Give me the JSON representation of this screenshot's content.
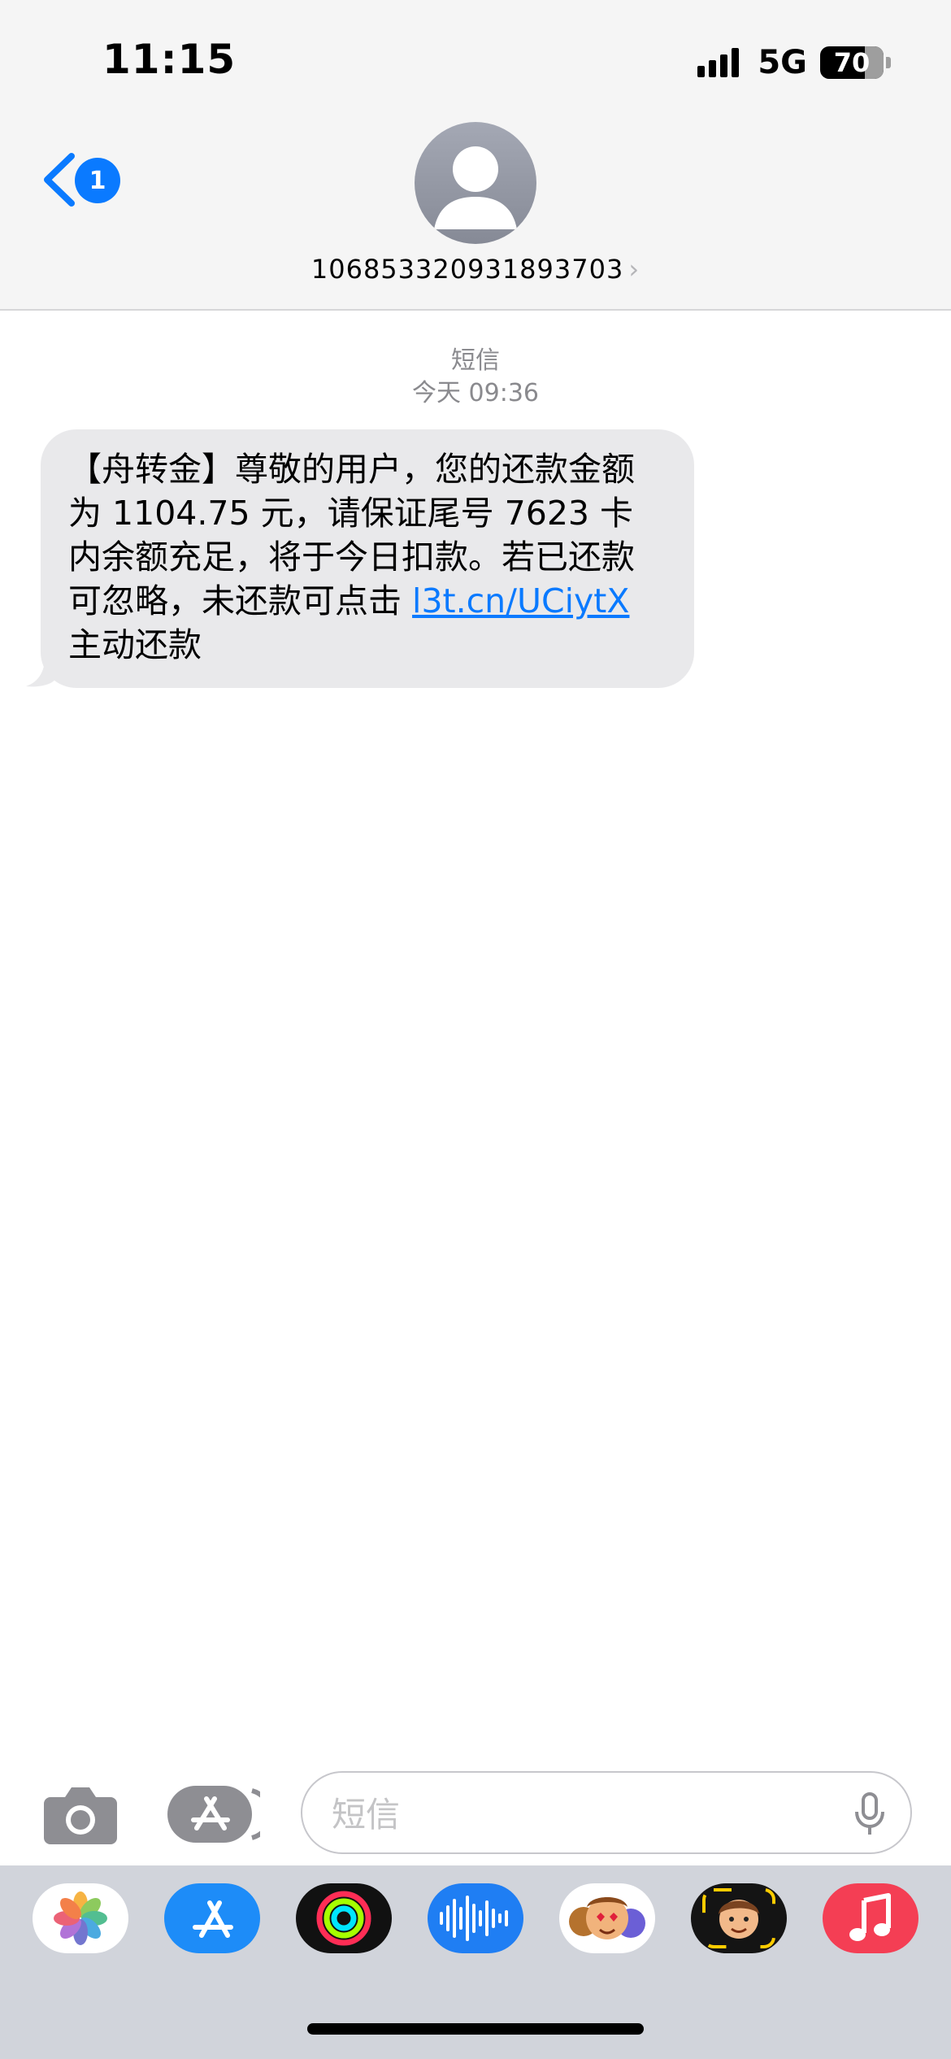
{
  "status_bar": {
    "time": "11:15",
    "network": "5G",
    "battery": "70",
    "battery_level_percent": 70
  },
  "nav": {
    "back_badge": "1",
    "back_icon": "chevron-left-icon",
    "avatar_icon": "person-icon",
    "contact_name": "106853320931893703",
    "contact_chevron": "›"
  },
  "thread": {
    "service_label": "短信",
    "timestamp": "今天 09:36",
    "message": {
      "text_before_link": "【舟转金】尊敬的用户，您的还款金额为 1104.75 元，请保证尾号 7623 卡内余额充足，将于今日扣款。若已还款可忽略，未还款可点击 ",
      "link_text": "l3t.cn/UCiytX",
      "text_after_link": " 主动还款"
    }
  },
  "input_bar": {
    "camera_icon": "camera-icon",
    "apps_icon": "app-store-icon",
    "placeholder": "短信",
    "value": "",
    "mic_icon": "microphone-icon"
  },
  "app_drawer": {
    "apps": [
      {
        "name": "photos",
        "icon": "photos-icon"
      },
      {
        "name": "app-store",
        "icon": "app-store-icon"
      },
      {
        "name": "fitness",
        "icon": "activity-rings-icon"
      },
      {
        "name": "audio-message",
        "icon": "waveform-icon"
      },
      {
        "name": "memoji-stickers",
        "icon": "memoji-stickers-icon"
      },
      {
        "name": "memoji",
        "icon": "memoji-icon"
      },
      {
        "name": "music",
        "icon": "music-note-icon"
      }
    ]
  },
  "colors": {
    "accent": "#0a7aff",
    "bubble_incoming": "#e9e9eb",
    "header_bg": "#f5f5f5",
    "drawer_bg": "#d1d4db",
    "secondary_text": "#8a8a8e"
  }
}
